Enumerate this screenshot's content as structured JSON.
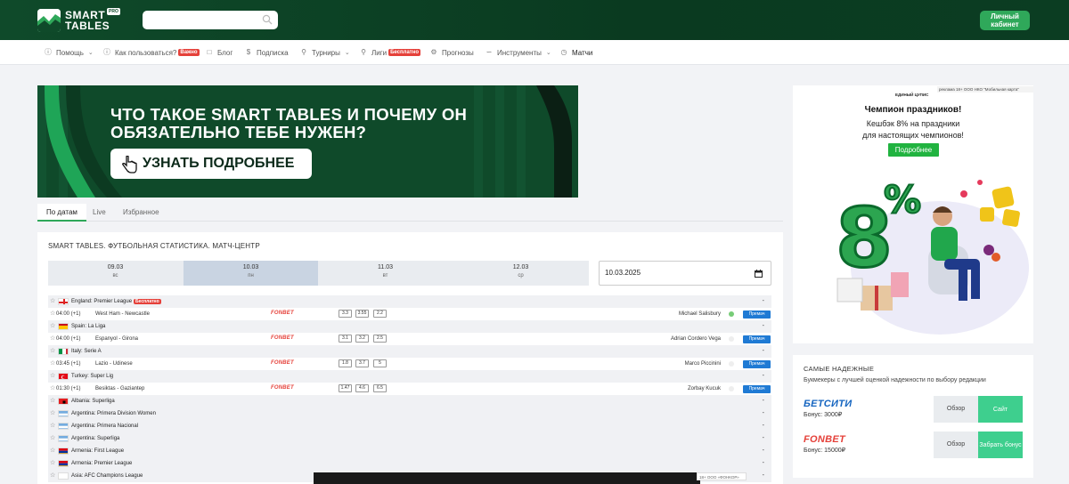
{
  "header": {
    "logo_line1": "SMART",
    "logo_line2": "TABLES",
    "logo_badge": "PRO",
    "search_placeholder": "",
    "cabinet_label": "Личный кабинет"
  },
  "nav": {
    "items": [
      {
        "label": "Помощь",
        "icon": "help-circle-icon",
        "has_dropdown": true
      },
      {
        "label": "Как пользоваться?",
        "icon": "help-circle-icon",
        "badge": "Важно"
      },
      {
        "label": "Блог",
        "icon": "document-icon"
      },
      {
        "label": "Подписка",
        "icon": "dollar-icon"
      },
      {
        "label": "Турниры",
        "icon": "trophy-icon",
        "has_dropdown": true
      },
      {
        "label": "Лиги",
        "icon": "trophy-icon",
        "badge": "Бесплатно"
      },
      {
        "label": "Прогнозы",
        "icon": "settings-icon"
      },
      {
        "label": "Инструменты",
        "icon": "chart-icon",
        "has_dropdown": true
      },
      {
        "label": "Матчи",
        "icon": "clock-icon"
      }
    ]
  },
  "banner": {
    "title": "ЧТО ТАКОЕ SMART TABLES И ПОЧЕМУ ОН ОБЯЗАТЕЛЬНО ТЕБЕ НУЖЕН?",
    "button_label": "УЗНАТЬ ПОДРОБНЕЕ"
  },
  "tabs": [
    "По датам",
    "Live",
    "Избранное"
  ],
  "main": {
    "title": "SMART TABLES. ФУТБОЛЬНАЯ СТАТИСТИКА. МАТЧ-ЦЕНТР",
    "dates": [
      {
        "date": "09.03",
        "weekday": "вс"
      },
      {
        "date": "10.03",
        "weekday": "пн",
        "active": true
      },
      {
        "date": "11.03",
        "weekday": "вт"
      },
      {
        "date": "12.03",
        "weekday": "ср"
      }
    ],
    "date_value": "10.03.2025",
    "rows": [
      {
        "kind": "league",
        "name": "England: Premier League",
        "badge": "Бесплатно",
        "flag": "england"
      },
      {
        "kind": "match",
        "time": "04:00 (+1)",
        "teams": "West Ham - Newcastle",
        "bookmaker": "FONBET",
        "odds": [
          "3.3",
          "3.55",
          "2.2"
        ],
        "tipster": "Michael Salisbury",
        "dot": "green",
        "premium": "Премач"
      },
      {
        "kind": "league",
        "name": "Spain: La Liga",
        "flag": "spain"
      },
      {
        "kind": "match",
        "time": "04:00 (+1)",
        "teams": "Espanyol - Girona",
        "bookmaker": "FONBET",
        "odds": [
          "3.1",
          "3.2",
          "2.5"
        ],
        "tipster": "Adrian Cordero Vega",
        "dot": "empty",
        "premium": "Премач"
      },
      {
        "kind": "league",
        "name": "Italy: Serie A",
        "flag": "italy"
      },
      {
        "kind": "match",
        "time": "03:45 (+1)",
        "teams": "Lazio - Udinese",
        "bookmaker": "FONBET",
        "odds": [
          "1.8",
          "3.7",
          "5"
        ],
        "tipster": "Marco Piccinini",
        "dot": "empty",
        "premium": "Премач"
      },
      {
        "kind": "league",
        "name": "Turkey: Super Lig",
        "flag": "turkey"
      },
      {
        "kind": "match",
        "time": "01:30 (+1)",
        "teams": "Besiktas - Gaziantep",
        "bookmaker": "FONBET",
        "odds": [
          "1.47",
          "4.6",
          "6.5"
        ],
        "tipster": "Zorbay Kucuk",
        "dot": "empty",
        "premium": "Премач"
      },
      {
        "kind": "league",
        "name": "Albania: Superliga",
        "flag": "albania"
      },
      {
        "kind": "league",
        "name": "Argentina: Primera Division Women",
        "flag": "argentina"
      },
      {
        "kind": "league",
        "name": "Argentina: Primera Nacional",
        "flag": "argentina"
      },
      {
        "kind": "league",
        "name": "Argentina: Superliga",
        "flag": "argentina"
      },
      {
        "kind": "league",
        "name": "Armenia: First League",
        "flag": "armenia"
      },
      {
        "kind": "league",
        "name": "Armenia: Premier League",
        "flag": "armenia"
      },
      {
        "kind": "league",
        "name": "Asia: AFC Champions League",
        "flag": "asia"
      }
    ],
    "dash": "-"
  },
  "video_ad_note": "18+ ООО «ФОНКОР»",
  "right_ad": {
    "brand": "ЕДИНЫЙ ЦУПИС",
    "note": "реклама 18+ ООО НКО \"Мобильная карта\"",
    "title": "Чемпион праздников!",
    "subtitle_line1": "Кешбэк 8% на праздники",
    "subtitle_line2": "для настоящих чемпионов!",
    "button_label": "Подробнее",
    "percent": "8%"
  },
  "reliable": {
    "title": "САМЫЕ НАДЕЖНЫЕ",
    "subtitle": "Букмекеры с лучшей оценкой надежности по выбору редакции",
    "bookmakers": [
      {
        "name": "БЕТСИТИ",
        "bonus": "Бонус: 3000₽",
        "review": "Обзор",
        "action": "Сайт",
        "color": "#1565c0"
      },
      {
        "name": "FONBET",
        "bonus": "Бонус: 15000₽",
        "review": "Обзор",
        "action": "Забрать бонус",
        "color": "#e5413a"
      }
    ]
  }
}
